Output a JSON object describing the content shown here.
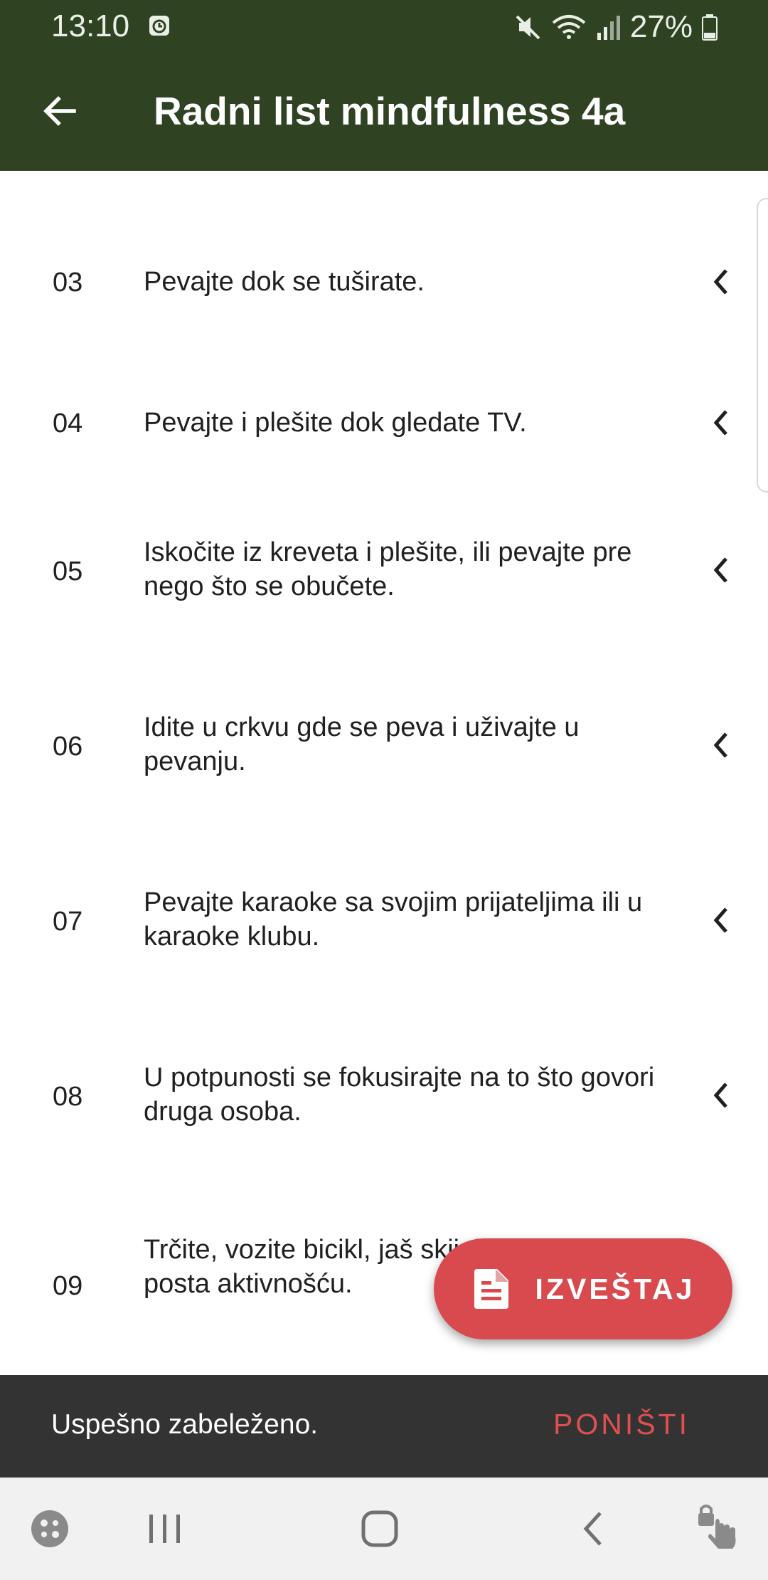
{
  "status_bar": {
    "time": "13:10",
    "battery": "27%",
    "icons": [
      "alarm-icon",
      "mute-icon",
      "wifi-icon",
      "signal-icon",
      "battery-icon"
    ]
  },
  "app_bar": {
    "title": "Radni list mindfulness 4a",
    "back_icon": "arrow-back-icon"
  },
  "list": {
    "items": [
      {
        "number": "03",
        "text": "Pevajte dok se tuširate."
      },
      {
        "number": "04",
        "text": "Pevajte i plešite dok gledate TV."
      },
      {
        "number": "05",
        "text": "Iskočite iz kreveta i plešite, ili pevajte pre nego što se obučete."
      },
      {
        "number": "06",
        "text": "Idite u crkvu gde se peva i uživajte u pevanju."
      },
      {
        "number": "07",
        "text": "Pevajte karaoke sa svojim prijateljima ili u karaoke klubu."
      },
      {
        "number": "08",
        "text": "U potpunosti se fokusirajte na to što govori druga osoba."
      },
      {
        "number": "09",
        "text": "Trčite, vozite bicikl, jaš skijajte, šetajte; posta aktivnošću."
      }
    ]
  },
  "fab": {
    "label": "IZVEŠTAJ",
    "icon": "document-icon"
  },
  "snackbar": {
    "message": "Uspešno zabeleženo.",
    "action": "PONIŠTI"
  },
  "colors": {
    "app_bar": "#2f4323",
    "fab": "#d84a4d",
    "snackbar": "#333333",
    "snackbar_action": "#e04f4f"
  }
}
